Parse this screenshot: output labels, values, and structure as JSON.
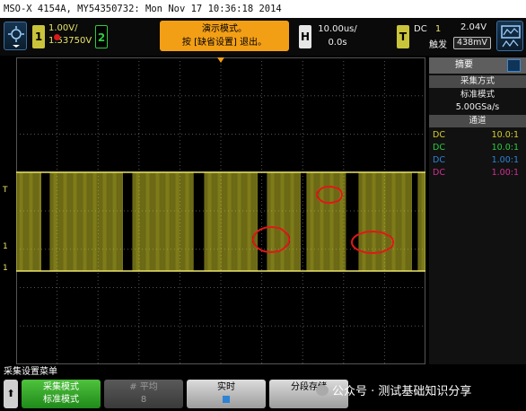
{
  "window": {
    "title": "MSO-X 4154A, MY54350732: Mon Nov 17 10:36:18 2014"
  },
  "top_bar": {
    "ch1_number": "1",
    "ch1_scale": "1.00V/",
    "ch1_offset": "1.53750V",
    "ch2_number": "2",
    "message_line1": "演示模式。",
    "message_line2": "按 [缺省设置] 退出。",
    "horizontal_tag": "H",
    "time_scale": "10.00us/",
    "time_delay": "0.0s",
    "trigger_tag": "T",
    "trigger_coupling": "DC",
    "trigger_source": "1",
    "trigger_level_v": "2.04V",
    "trigger_mode": "触发",
    "trigger_holdoff": "438mV"
  },
  "markers": {
    "ch1_marker": "1",
    "trigger_marker": "T"
  },
  "right_panel": {
    "tab_label": "摘要",
    "section_acq": "采集方式",
    "acq_mode": "标准模式",
    "sample_rate": "5.00GSa/s",
    "section_channels": "通道",
    "channels": [
      {
        "coupling": "DC",
        "ratio": "10.0:1",
        "color": "#d4cf2a"
      },
      {
        "coupling": "DC",
        "ratio": "10.0:1",
        "color": "#2ecc40"
      },
      {
        "coupling": "DC",
        "ratio": "1.00:1",
        "color": "#2f83d4"
      },
      {
        "coupling": "DC",
        "ratio": "1.00:1",
        "color": "#d0308f"
      }
    ]
  },
  "menu": {
    "title": "采集设置菜单",
    "back_symbol": "⬆",
    "mode_label": "采集模式",
    "mode_value": "标准模式",
    "avg_label": "# 平均",
    "avg_value": "8",
    "realtime_label": "实时",
    "segment_label": "分段存储"
  },
  "watermark": "公众号 · 测试基础知识分享",
  "colors": {
    "ch1": "#d4cf2a",
    "ch2": "#2ecc40",
    "menu_active": "#3aa82e",
    "message": "#f39f16",
    "annotation": "#e01818"
  },
  "icons": {
    "run": "run-stop-icon",
    "display": "display-icon",
    "summary": "summary-icon"
  }
}
